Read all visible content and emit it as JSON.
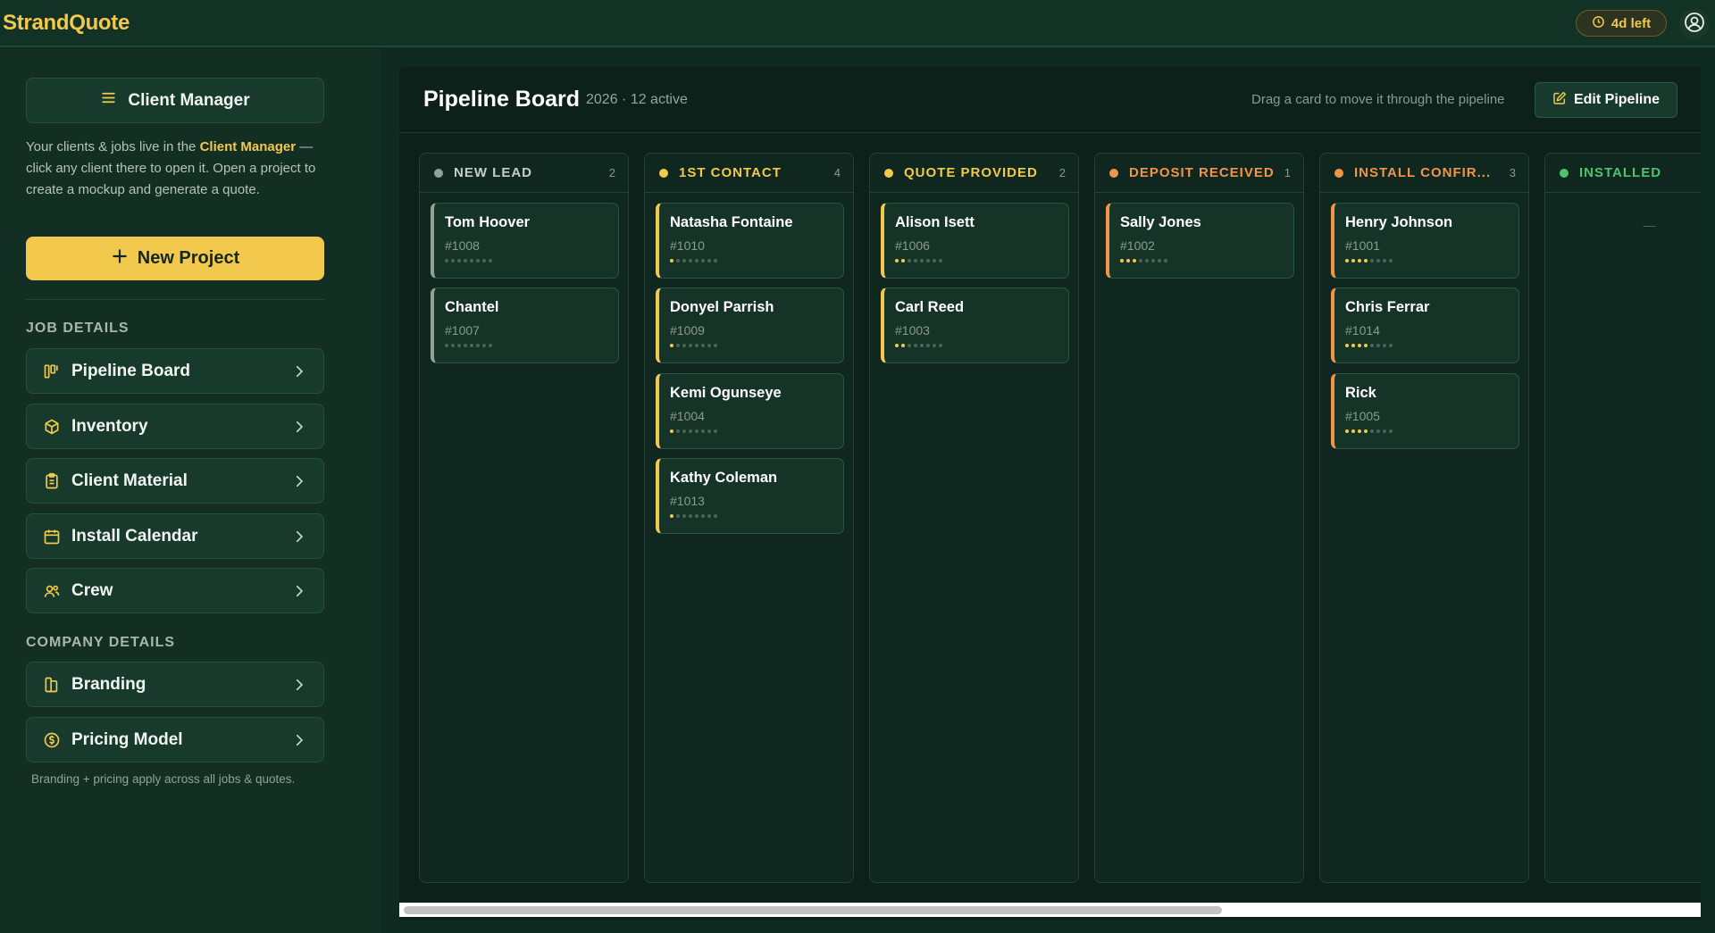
{
  "topbar": {
    "brand": "StrandQuote",
    "trial_label": "4d left"
  },
  "sidebar": {
    "client_manager_label": "Client Manager",
    "help": {
      "part1": "Your clients & jobs live in the ",
      "link": "Client Manager",
      "part2": " — click any client there to open it. Open a project to create a mockup and generate a quote."
    },
    "new_project_label": "New Project",
    "job_details_title": "JOB DETAILS",
    "job_items": [
      {
        "label": "Pipeline Board",
        "icon": "kanban-icon"
      },
      {
        "label": "Inventory",
        "icon": "box-icon"
      },
      {
        "label": "Client Material",
        "icon": "clipboard-icon"
      },
      {
        "label": "Install Calendar",
        "icon": "calendar-icon"
      },
      {
        "label": "Crew",
        "icon": "users-icon"
      }
    ],
    "company_details_title": "COMPANY DETAILS",
    "company_items": [
      {
        "label": "Branding",
        "icon": "swatch-book-icon"
      },
      {
        "label": "Pricing Model",
        "icon": "dollar-circle-icon"
      }
    ],
    "footer_note": "Branding + pricing apply across all jobs & quotes."
  },
  "board": {
    "title": "Pipeline Board",
    "subtitle": "2026 · 12 active",
    "hint": "Drag a card to move it through the pipeline",
    "edit_label": "Edit Pipeline",
    "columns": [
      {
        "name": "NEW LEAD",
        "count": "2",
        "color": "#8fa39a",
        "cards": [
          {
            "name": "Tom Hoover",
            "id": "#1008",
            "progress": 0
          },
          {
            "name": "Chantel",
            "id": "#1007",
            "progress": 0
          }
        ]
      },
      {
        "name": "1ST CONTACT",
        "count": "4",
        "color": "#f2c94c",
        "cards": [
          {
            "name": "Natasha Fontaine",
            "id": "#1010",
            "progress": 1
          },
          {
            "name": "Donyel Parrish",
            "id": "#1009",
            "progress": 1
          },
          {
            "name": "Kemi Ogunseye",
            "id": "#1004",
            "progress": 1
          },
          {
            "name": "Kathy Coleman",
            "id": "#1013",
            "progress": 1
          }
        ]
      },
      {
        "name": "QUOTE PROVIDED",
        "count": "2",
        "color": "#f2c94c",
        "cards": [
          {
            "name": "Alison Isett",
            "id": "#1006",
            "progress": 2
          },
          {
            "name": "Carl Reed",
            "id": "#1003",
            "progress": 2
          }
        ]
      },
      {
        "name": "DEPOSIT RECEIVED",
        "count": "1",
        "color": "#f0954a",
        "cards": [
          {
            "name": "Sally Jones",
            "id": "#1002",
            "progress": 3
          }
        ]
      },
      {
        "name": "INSTALL CONFIR...",
        "count": "3",
        "color": "#f0954a",
        "cards": [
          {
            "name": "Henry Johnson",
            "id": "#1001",
            "progress": 4
          },
          {
            "name": "Chris Ferrar",
            "id": "#1014",
            "progress": 4
          },
          {
            "name": "Rick",
            "id": "#1005",
            "progress": 4
          }
        ]
      },
      {
        "name": "INSTALLED",
        "count": "",
        "color": "#4fc36d",
        "empty_text": "—",
        "cards": []
      }
    ],
    "progress_steps": 8
  }
}
